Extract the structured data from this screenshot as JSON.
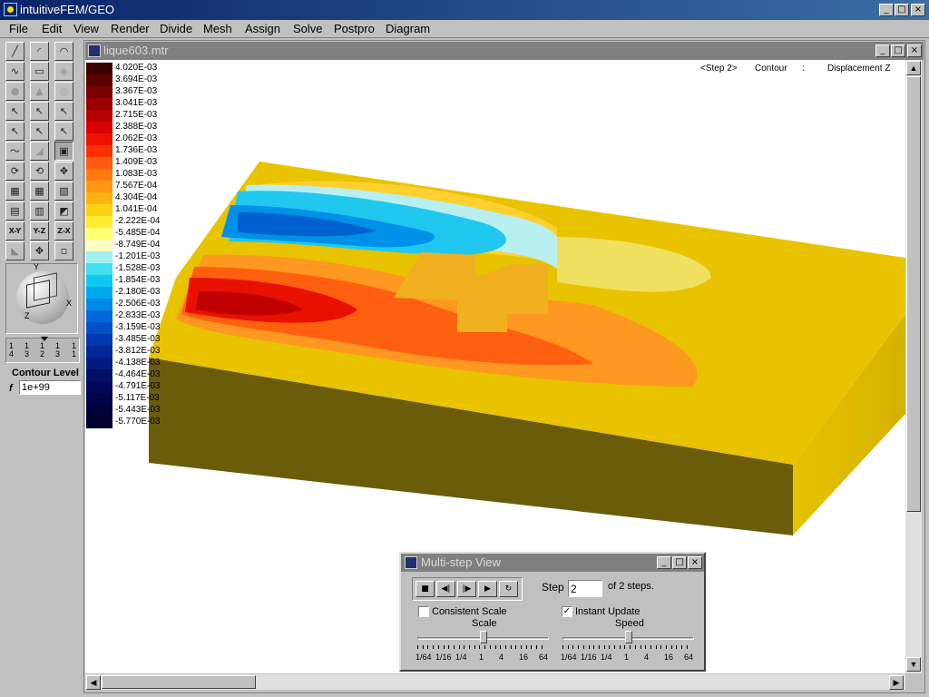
{
  "app": {
    "title": "intuitiveFEM/GEO"
  },
  "menubar": {
    "items": [
      "File",
      "Edit",
      "View",
      "Render",
      "Divide",
      "Mesh",
      "Assign",
      "Solve",
      "Postpro",
      "Diagram"
    ]
  },
  "document": {
    "title": "lique603.mtr"
  },
  "view_info": {
    "step": "<Step 2>",
    "mode": "Contour",
    "separator": ":",
    "quantity": "Displacement Z"
  },
  "legend": {
    "labels": [
      "4.020E-03",
      "3.694E-03",
      "3.367E-03",
      "3.041E-03",
      "2.715E-03",
      "2.388E-03",
      "2.062E-03",
      "1.736E-03",
      "1.409E-03",
      "1.083E-03",
      "7.567E-04",
      "4.304E-04",
      "1.041E-04",
      "-2.222E-04",
      "-5.485E-04",
      "-8.749E-04",
      "-1.201E-03",
      "-1.528E-03",
      "-1.854E-03",
      "-2.180E-03",
      "-2.506E-03",
      "-2.833E-03",
      "-3.159E-03",
      "-3.485E-03",
      "-3.812E-03",
      "-4.138E-03",
      "-4.464E-03",
      "-4.791E-03",
      "-5.117E-03",
      "-5.443E-03",
      "-5.770E-03"
    ],
    "colors": [
      "#3a0000",
      "#5a0000",
      "#7a0000",
      "#9a0000",
      "#b80000",
      "#d80000",
      "#f01000",
      "#ff3000",
      "#ff5a10",
      "#ff7a10",
      "#ff9810",
      "#ffb310",
      "#ffd010",
      "#ffec30",
      "#ffff70",
      "#ffffc0",
      "#a0f0f0",
      "#40e0f0",
      "#10c8f0",
      "#00a8f0",
      "#0088e8",
      "#0068d8",
      "#0050c8",
      "#0038b0",
      "#002898",
      "#001c80",
      "#001068",
      "#000858",
      "#000448",
      "#000238",
      "#000028"
    ]
  },
  "toolbox": {
    "contour_level_label": "Contour Level",
    "f_label": "f",
    "contour_level_value": "1e+99",
    "plane_buttons": [
      "X-Y",
      "Y-Z",
      "Z-X"
    ],
    "step_labels": [
      "1 4",
      "1 3",
      "1 2",
      "1 3",
      "1 1"
    ],
    "axes": {
      "y": "Y",
      "x": "X",
      "z": "Z"
    }
  },
  "multistep": {
    "title": "Multi-step View",
    "step_label": "Step",
    "step_value": "2",
    "of_steps": "of 2 steps.",
    "consistent_scale_label": "Consistent Scale",
    "consistent_scale_checked": false,
    "instant_update_label": "Instant Update",
    "instant_update_checked": true,
    "scale_label": "Scale",
    "speed_label": "Speed",
    "scale_ticks": [
      "1/64",
      "1/16",
      "1/4",
      "1",
      "4",
      "16",
      "64"
    ],
    "speed_ticks": [
      "1/64",
      "1/16",
      "1/4",
      "1",
      "4",
      "16",
      "64"
    ],
    "scale_value": "1",
    "speed_value": "1",
    "check_mark": "✓",
    "playback": [
      "stop",
      "step-back",
      "step-forward",
      "play",
      "loop"
    ]
  },
  "icons": {
    "minimize": "_",
    "maximize": "□",
    "close": "×",
    "scroll_up": "▲",
    "scroll_down": "▼",
    "scroll_left": "◀",
    "scroll_right": "▶",
    "stop": "■",
    "step_back": "◀|",
    "step_forward": "|▶",
    "play": "▶",
    "loop": "↻"
  },
  "colors": {
    "title_bar": "#0a246a",
    "solid_side": "#7a6a10",
    "solid_top": "#e8c800",
    "window_bg": "#c0c0c0"
  }
}
